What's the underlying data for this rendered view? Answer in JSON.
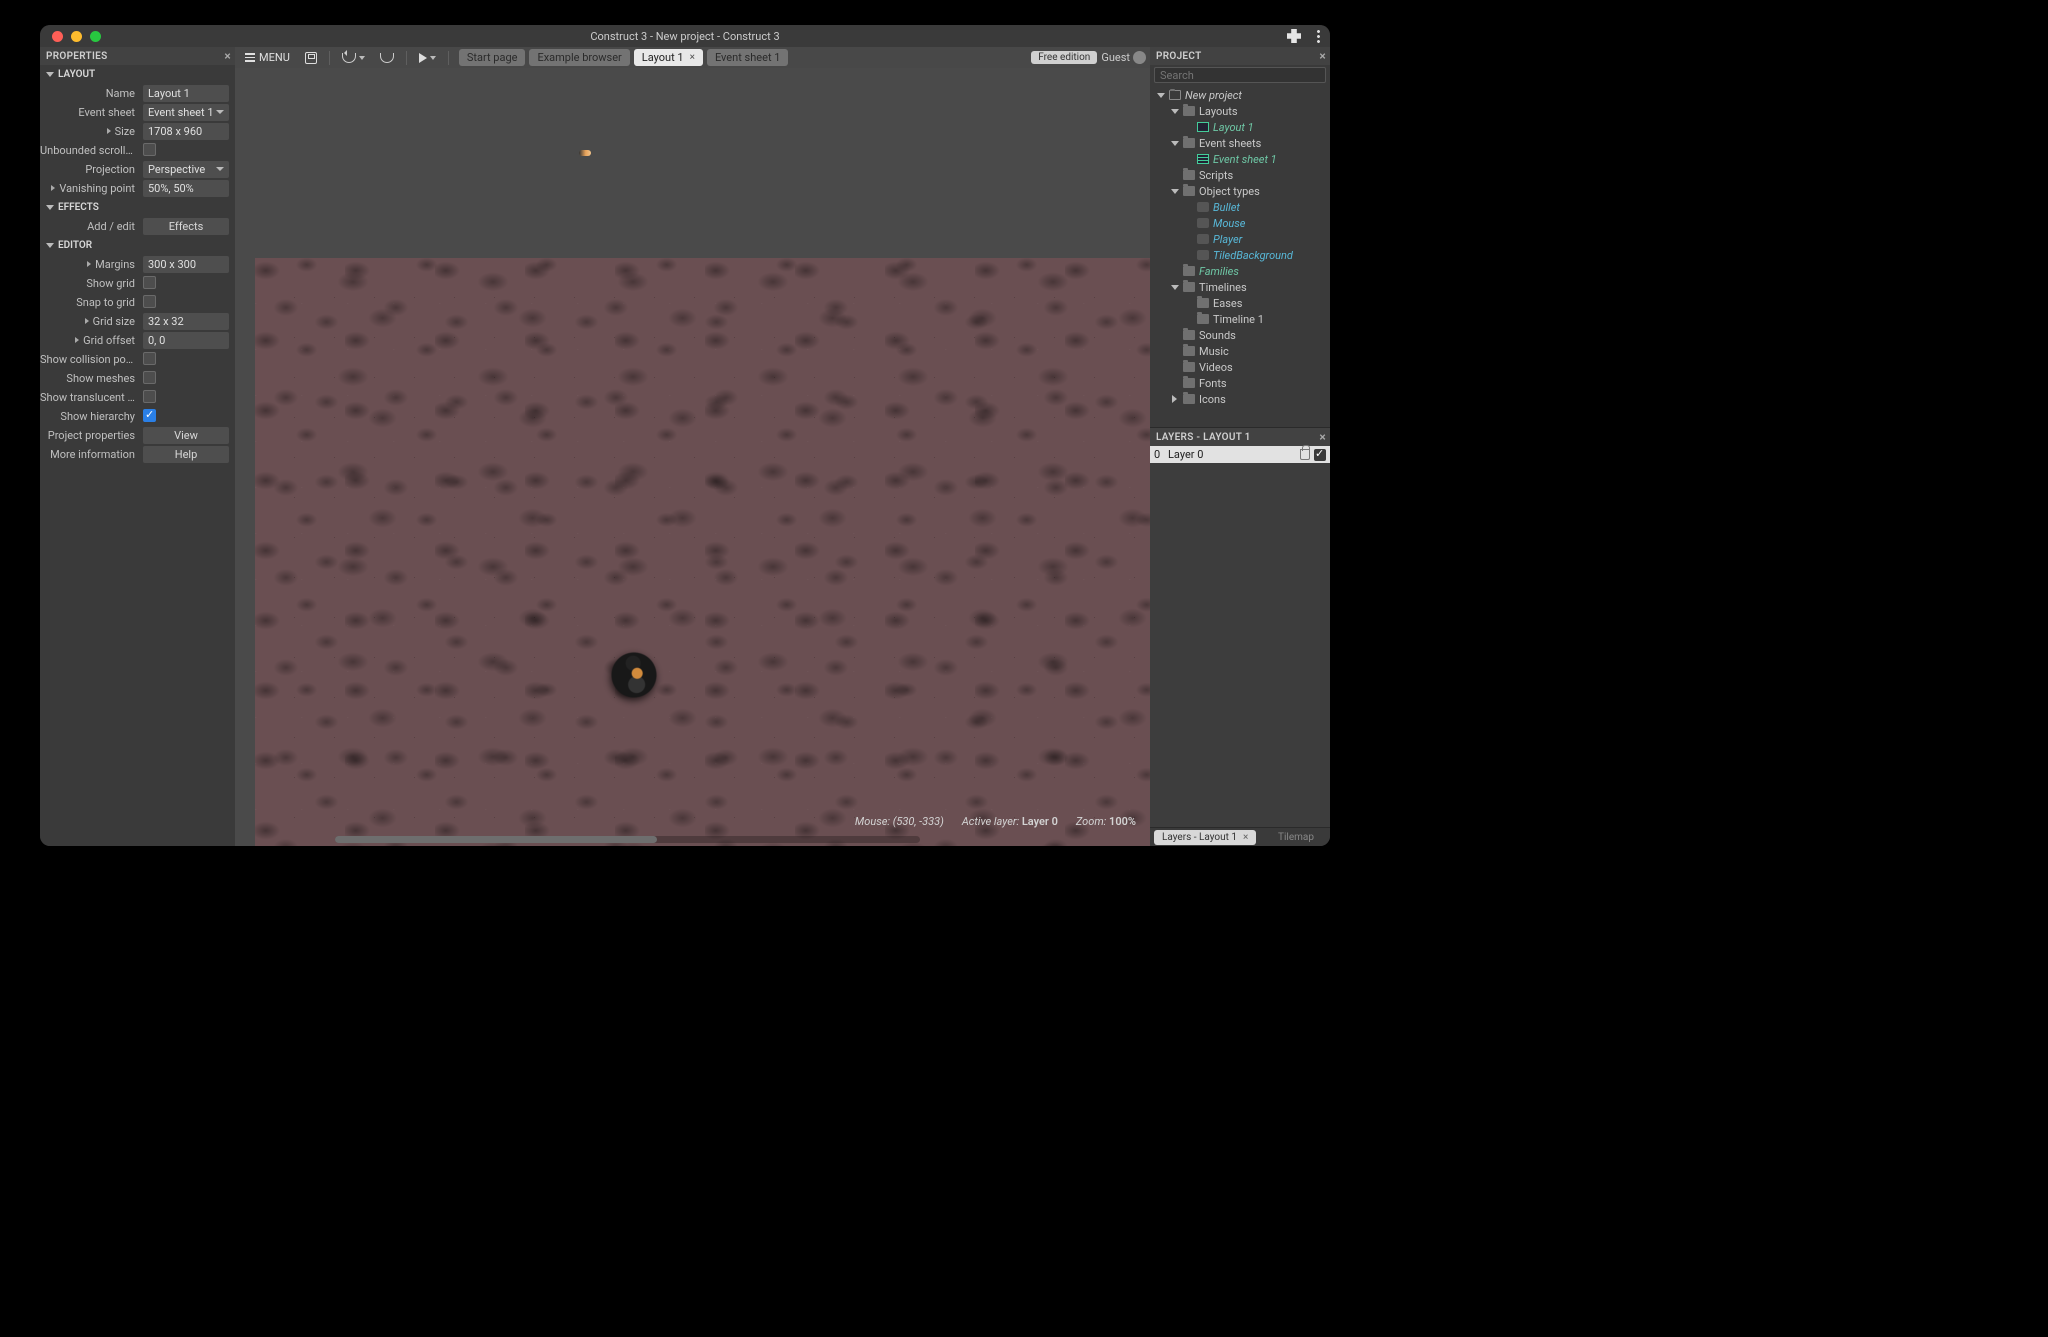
{
  "title": "Construct 3 - New project - Construct 3",
  "toolbar": {
    "menu": "MENU",
    "tabs": [
      {
        "label": "Start page",
        "active": false,
        "close": false
      },
      {
        "label": "Example browser",
        "active": false,
        "close": false
      },
      {
        "label": "Layout 1",
        "active": true,
        "close": true
      },
      {
        "label": "Event sheet 1",
        "active": false,
        "close": false
      }
    ],
    "free": "Free edition",
    "guest": "Guest"
  },
  "properties": {
    "title": "PROPERTIES",
    "sections": {
      "layout": "LAYOUT",
      "effects": "EFFECTS",
      "editor": "EDITOR"
    },
    "rows": {
      "name_label": "Name",
      "name_value": "Layout 1",
      "es_label": "Event sheet",
      "es_value": "Event sheet 1",
      "size_label": "Size",
      "size_value": "1708 x 960",
      "unb_label": "Unbounded scrolli...",
      "proj_label": "Projection",
      "proj_value": "Perspective",
      "vp_label": "Vanishing point",
      "vp_value": "50%, 50%",
      "addedit_label": "Add / edit",
      "addedit_btn": "Effects",
      "margins_label": "Margins",
      "margins_value": "300 x 300",
      "showgrid_label": "Show grid",
      "snap_label": "Snap to grid",
      "gsize_label": "Grid size",
      "gsize_value": "32 x 32",
      "goff_label": "Grid offset",
      "goff_value": "0, 0",
      "coll_label": "Show collision pol...",
      "mesh_label": "Show meshes",
      "trans_label": "Show translucent i...",
      "hier_label": "Show hierarchy",
      "pp_label": "Project properties",
      "pp_btn": "View",
      "more_label": "More information",
      "more_btn": "Help"
    }
  },
  "project": {
    "title": "PROJECT",
    "search_ph": "Search",
    "tree": {
      "root": "New project",
      "layouts": "Layouts",
      "layout1": "Layout 1",
      "es": "Event sheets",
      "es1": "Event sheet 1",
      "scripts": "Scripts",
      "ot": "Object types",
      "bullet": "Bullet",
      "mouse": "Mouse",
      "player": "Player",
      "tiled": "TiledBackground",
      "families": "Families",
      "timelines": "Timelines",
      "eases": "Eases",
      "timeline1": "Timeline 1",
      "sounds": "Sounds",
      "music": "Music",
      "videos": "Videos",
      "fonts": "Fonts",
      "icons": "Icons"
    }
  },
  "layers": {
    "title": "LAYERS - LAYOUT 1",
    "layer0_num": "0",
    "layer0_name": "Layer 0",
    "tab_active": "Layers - Layout 1",
    "tab_inactive": "Tilemap"
  },
  "status": {
    "mouse_l": "Mouse:",
    "mouse_v": "(530, -333)",
    "layer_l": "Active layer:",
    "layer_v": "Layer 0",
    "zoom_l": "Zoom:",
    "zoom_v": "100%"
  }
}
